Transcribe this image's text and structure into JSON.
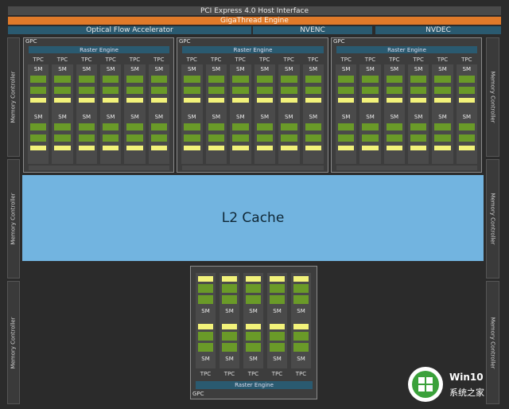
{
  "top": {
    "pcie": "PCI Express 4.0 Host Interface",
    "gigathread": "GigaThread Engine",
    "ofa": "Optical Flow Accelerator",
    "nvenc": "NVENC",
    "nvdec": "NVDEC"
  },
  "memory_controller": "Memory Controller",
  "gpc_label": "GPC",
  "raster_engine": "Raster Engine",
  "tpc_label": "TPC",
  "sm_label": "SM",
  "l2_cache": "L2 Cache",
  "watermark": {
    "brand": "Win10",
    "sub": "系统之家"
  },
  "colors": {
    "pcie_bar": "#4a4a4a",
    "gigathread_bar": "#e07a2a",
    "teal_bar": "#2a5a70",
    "l2": "#72b4e0",
    "core_green": "#6a9a28",
    "cache_yellow": "#f2f27a"
  }
}
